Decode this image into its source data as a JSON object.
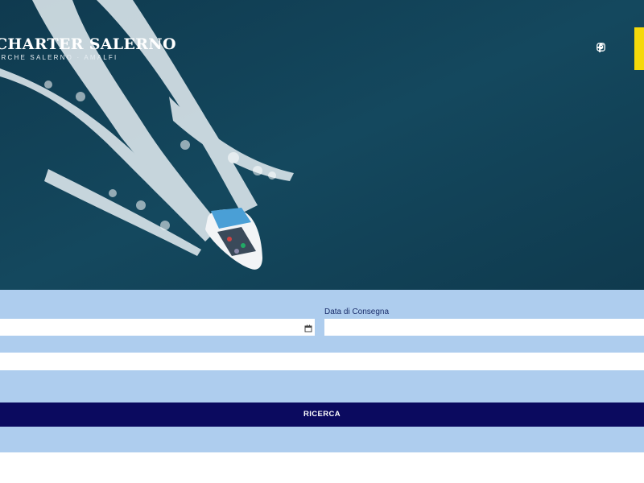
{
  "brand": {
    "title": "CHARTER SALERNO",
    "subtitle": "ARCHE SALERNO · AMALFI"
  },
  "social": {
    "icons": [
      "facebook-icon",
      "instagram-icon"
    ]
  },
  "form": {
    "delivery_date_label": "Data di Consegna",
    "search_button_label": "RICERCA"
  },
  "colors": {
    "sea": "#123f52",
    "form_bg": "#aecdee",
    "button_bg": "#0b0a5f",
    "accent_tab": "#f5d90a"
  }
}
